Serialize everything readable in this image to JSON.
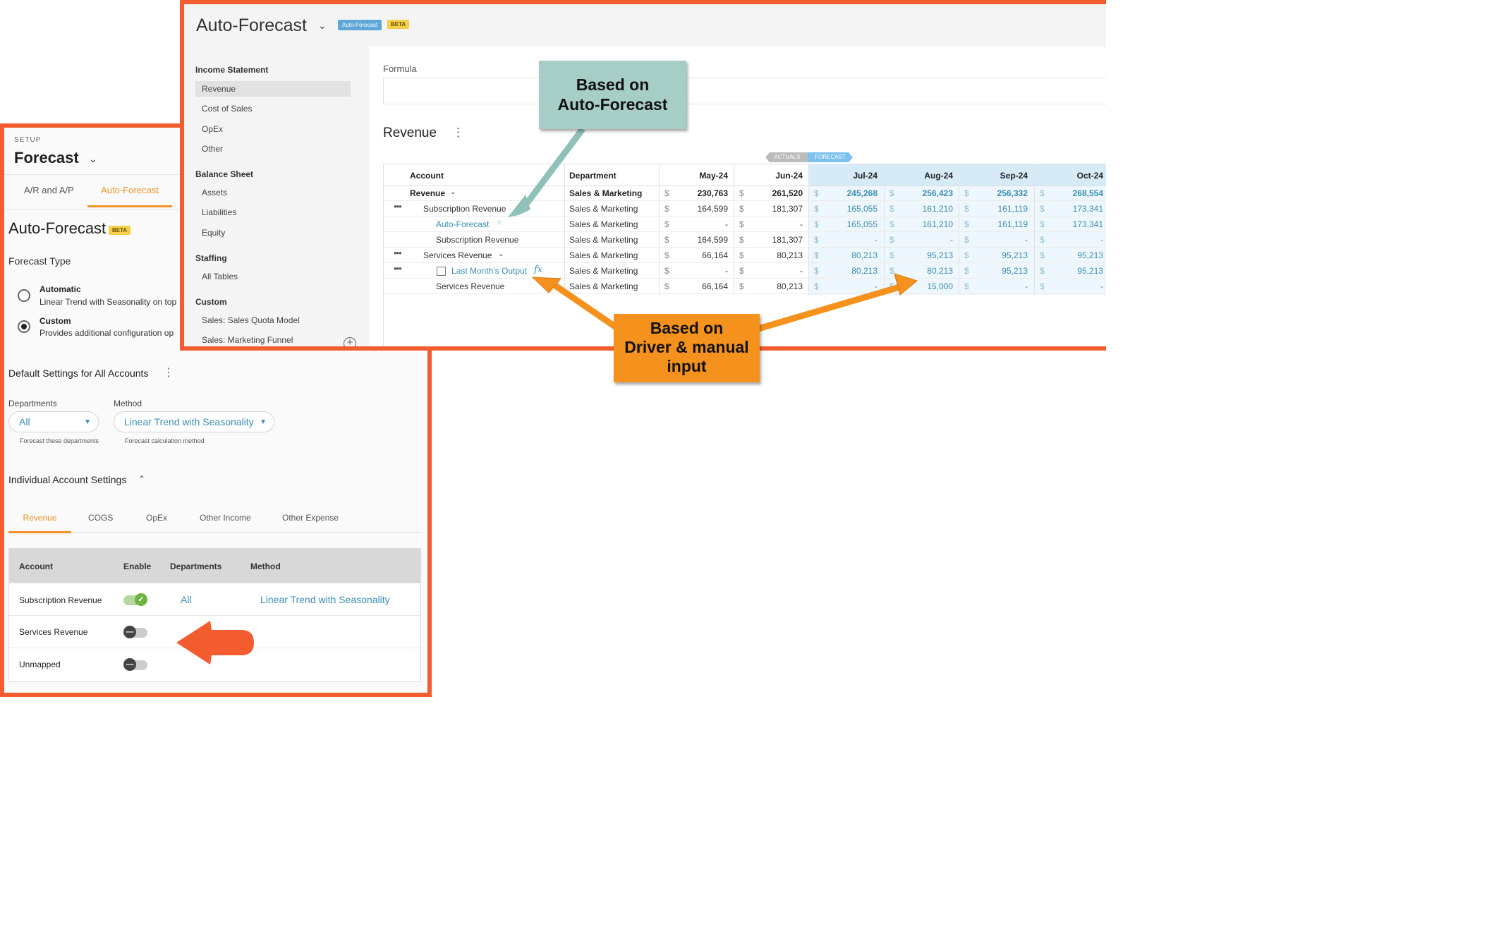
{
  "setup": {
    "label": "SETUP",
    "title": "Forecast",
    "tabs": [
      "A/R and A/P",
      "Auto-Forecast"
    ],
    "page_title": "Auto-Forecast",
    "beta": "BETA",
    "forecast_type_label": "Forecast Type",
    "options": [
      {
        "title": "Automatic",
        "desc": "Linear Trend with Seasonality on top",
        "selected": false
      },
      {
        "title": "Custom",
        "desc": "Provides additional configuration op",
        "selected": true
      }
    ],
    "defaults_title": "Default Settings for All Accounts",
    "departments_label": "Departments",
    "departments_value": "All",
    "departments_help": "Forecast these departments",
    "method_label": "Method",
    "method_value": "Linear Trend with Seasonality",
    "method_help": "Forecast calculation method",
    "individual_title": "Individual Account Settings",
    "account_tabs": [
      "Revenue",
      "COGS",
      "OpEx",
      "Other Income",
      "Other Expense"
    ],
    "grid_headers": [
      "Account",
      "Enable",
      "Departments",
      "Method"
    ],
    "grid_rows": [
      {
        "account": "Subscription Revenue",
        "enabled": true,
        "departments": "All",
        "method": "Linear Trend with Seasonality"
      },
      {
        "account": "Services Revenue",
        "enabled": false,
        "departments": "",
        "method": ""
      },
      {
        "account": "Unmapped",
        "enabled": false,
        "departments": "",
        "method": ""
      }
    ]
  },
  "af": {
    "title": "Auto-Forecast",
    "tag": "Auto-Forecast",
    "beta": "BETA",
    "sidebar": {
      "groups": [
        {
          "head": "Income Statement",
          "items": [
            "Revenue",
            "Cost of Sales",
            "OpEx",
            "Other"
          ]
        },
        {
          "head": "Balance Sheet",
          "items": [
            "Assets",
            "Liabilities",
            "Equity"
          ]
        },
        {
          "head": "Staffing",
          "items": [
            "All Tables"
          ]
        },
        {
          "head": "Custom",
          "items": [
            "Sales: Sales Quota Model",
            "Sales: Marketing Funnel"
          ]
        }
      ],
      "active": "Revenue"
    },
    "formula_label": "Formula",
    "section_title": "Revenue",
    "actuals_tag": "ACTUALS",
    "forecast_tag": "FORECAST",
    "headers": {
      "account": "Account",
      "department": "Department",
      "months": [
        "May-24",
        "Jun-24",
        "Jul-24",
        "Aug-24",
        "Sep-24",
        "Oct-24"
      ]
    },
    "currency": "$",
    "rows": [
      {
        "account": "Revenue",
        "department": "Sales & Marketing",
        "values": [
          "230,763",
          "261,520",
          "245,268",
          "256,423",
          "256,332",
          "268,554"
        ]
      },
      {
        "account": "Subscription Revenue",
        "department": "Sales & Marketing",
        "values": [
          "164,599",
          "181,307",
          "165,055",
          "161,210",
          "161,119",
          "173,341"
        ]
      },
      {
        "account": "Auto-Forecast",
        "department": "Sales & Marketing",
        "values": [
          "-",
          "-",
          "165,055",
          "161,210",
          "161,119",
          "173,341"
        ]
      },
      {
        "account": "Subscription Revenue",
        "department": "Sales & Marketing",
        "values": [
          "164,599",
          "181,307",
          "-",
          "-",
          "-",
          "-"
        ]
      },
      {
        "account": "Services Revenue",
        "department": "Sales & Marketing",
        "values": [
          "66,164",
          "80,213",
          "80,213",
          "95,213",
          "95,213",
          "95,213"
        ]
      },
      {
        "account": "Last Month's Output",
        "department": "Sales & Marketing",
        "values": [
          "-",
          "-",
          "80,213",
          "80,213",
          "95,213",
          "95,213"
        ]
      },
      {
        "account": "Services Revenue",
        "department": "Sales & Marketing",
        "values": [
          "66,164",
          "80,213",
          "-",
          "15,000",
          "-",
          "-"
        ]
      }
    ]
  },
  "callouts": {
    "auto_forecast": [
      "Based on",
      "Auto-Forecast"
    ],
    "driver": [
      "Based on",
      "Driver & manual",
      "input"
    ]
  },
  "colors": {
    "border": "#f25c2e",
    "accent": "#f0922b",
    "link": "#3c8db3",
    "teal_callout": "#a6cdc6",
    "orange_callout": "#f5921e"
  }
}
